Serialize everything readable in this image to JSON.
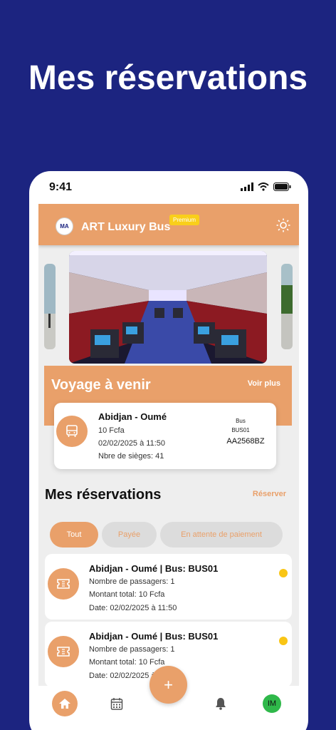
{
  "promo": {
    "title": "Mes réservations"
  },
  "status_bar": {
    "time": "9:41"
  },
  "header": {
    "logo_text": "MA",
    "app_name": "ART Luxury Bus",
    "badge": "Premium"
  },
  "upcoming": {
    "title": "Voyage à venir",
    "see_more": "Voir plus",
    "trip": {
      "route": "Abidjan - Oumé",
      "price": "10 Fcfa",
      "datetime": "02/02/2025 à 11:50",
      "seats": "Nbre de sièges: 41",
      "bus_label": "Bus",
      "bus_code": "BUS01",
      "plate": "AA2568BZ"
    }
  },
  "reservations": {
    "title": "Mes réservations",
    "book_link": "Réserver",
    "filters": [
      "Tout",
      "Payée",
      "En attente de paiement"
    ],
    "active_filter": "Tout",
    "items": [
      {
        "title": "Abidjan - Oumé | Bus: BUS01",
        "passengers": "Nombre de passagers: 1",
        "total": "Montant total: 10 Fcfa",
        "date": "Date: 02/02/2025 à 11:50",
        "status_color": "#f9c515"
      },
      {
        "title": "Abidjan - Oumé | Bus: BUS01",
        "passengers": "Nombre de passagers: 1",
        "total": "Montant total: 10 Fcfa",
        "date": "Date: 02/02/2025 à 11:50",
        "status_color": "#f9c515"
      }
    ]
  },
  "bottom_nav": {
    "fab_label": "+",
    "avatar_initials": "IM",
    "icons": [
      "home-icon",
      "calendar-icon",
      "bell-icon"
    ]
  },
  "colors": {
    "brand": "#e9a06a",
    "background": "#1c2480",
    "premium": "#f9cf1a",
    "pending": "#f9c515",
    "avatar": "#2fb84a"
  }
}
